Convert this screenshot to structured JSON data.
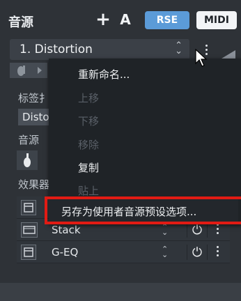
{
  "header": {
    "title": "音源",
    "add_label": "+",
    "a_label": "A",
    "rse_label": "RSE",
    "midi_label": "MIDI"
  },
  "source": {
    "selected": "1. Distortion",
    "updown_up": "⌃",
    "updown_down": "⌄"
  },
  "sections": {
    "tag_label": "标签扌",
    "tag_value": "Disto",
    "instrument_label": "音源",
    "effects_label": "效果器"
  },
  "effects": [
    {
      "name": "Stack",
      "icon": "amp-icon"
    },
    {
      "name": "G-EQ",
      "icon": "pedal-icon"
    }
  ],
  "menu": {
    "items": [
      {
        "label": "重新命名...",
        "enabled": true
      },
      {
        "label": "上移",
        "enabled": false
      },
      {
        "label": "下移",
        "enabled": false
      },
      {
        "label": "移除",
        "enabled": false
      },
      {
        "label": "复制",
        "enabled": true
      },
      {
        "label": "贴上",
        "enabled": false
      },
      {
        "label": "另存为使用者音源预设选项...",
        "enabled": true
      }
    ]
  },
  "colors": {
    "accent": "#5b9bd8",
    "highlight": "#e11b14"
  }
}
